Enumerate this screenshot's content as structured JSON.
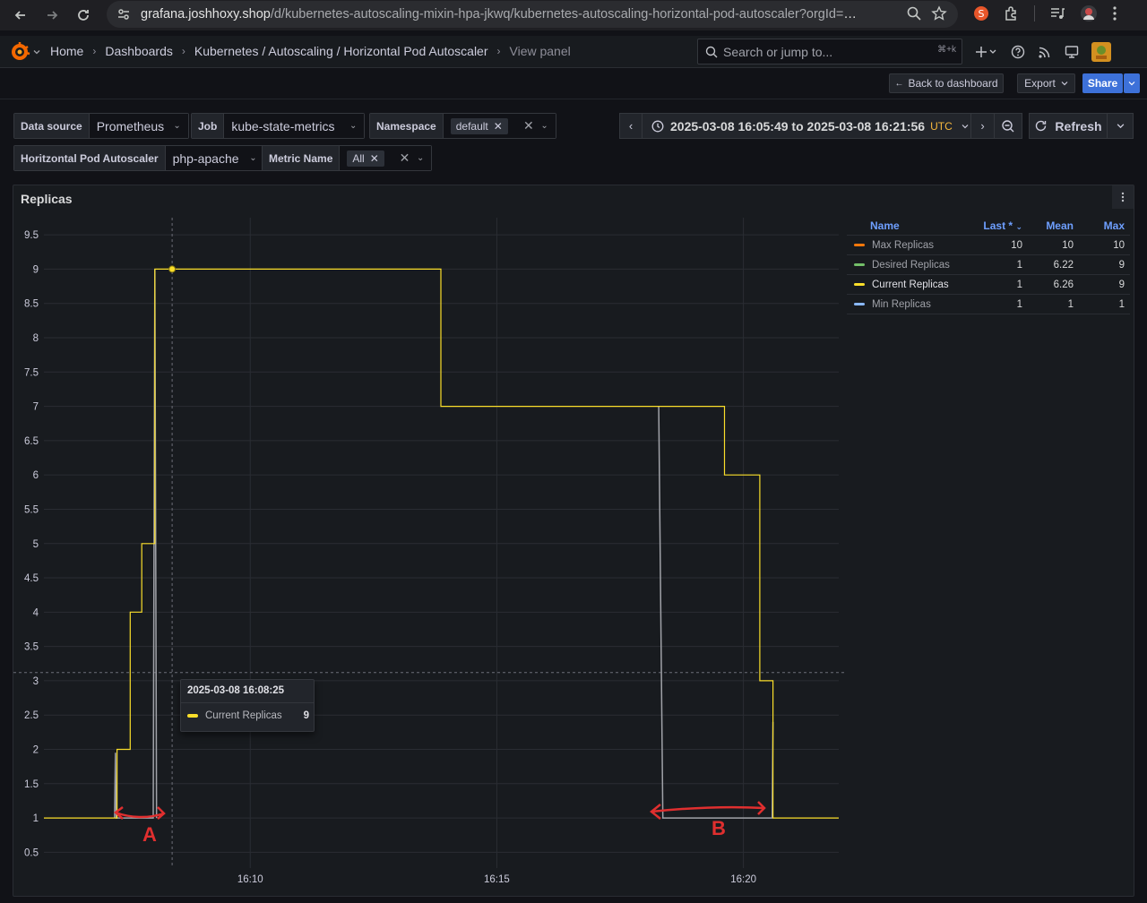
{
  "browser": {
    "url_host": "grafana.joshhoxy.shop",
    "url_path": "/d/kubernetes-autoscaling-mixin-hpa-jkwq/kubernetes-autoscaling-horizontal-pod-autoscaler?orgId="
  },
  "nav": {
    "breadcrumbs": [
      "Home",
      "Dashboards",
      "Kubernetes / Autoscaling / Horizontal Pod Autoscaler",
      "View panel"
    ],
    "search_placeholder": "Search or jump to...",
    "search_shortcut": "⌘+k"
  },
  "toolbar": {
    "back_label": "Back to dashboard",
    "export_label": "Export",
    "share_label": "Share"
  },
  "variables": {
    "datasource": {
      "label": "Data source",
      "value": "Prometheus"
    },
    "job": {
      "label": "Job",
      "value": "kube-state-metrics"
    },
    "namespace": {
      "label": "Namespace",
      "value": "default"
    },
    "hpa": {
      "label": "Horitzontal Pod Autoscaler",
      "value": "php-apache"
    },
    "metric": {
      "label": "Metric Name",
      "value": "All"
    }
  },
  "time": {
    "range": "2025-03-08 16:05:49 to 2025-03-08 16:21:56",
    "tz": "UTC",
    "refresh_label": "Refresh"
  },
  "panel": {
    "title": "Replicas"
  },
  "legend": {
    "headers": {
      "name": "Name",
      "last": "Last *",
      "mean": "Mean",
      "max": "Max"
    },
    "rows": [
      {
        "name": "Max Replicas",
        "color": "#ff780a",
        "last": "10",
        "mean": "10",
        "max": "10"
      },
      {
        "name": "Desired Replicas",
        "color": "#73bf69",
        "last": "1",
        "mean": "6.22",
        "max": "9"
      },
      {
        "name": "Current Replicas",
        "color": "#fade2a",
        "last": "1",
        "mean": "6.26",
        "max": "9"
      },
      {
        "name": "Min Replicas",
        "color": "#8ab8ff",
        "last": "1",
        "mean": "1",
        "max": "1"
      }
    ]
  },
  "tooltip": {
    "time": "2025-03-08 16:08:25",
    "series": "Current Replicas",
    "value": "9"
  },
  "annotations": {
    "a": "A",
    "b": "B"
  },
  "chart_data": {
    "type": "line",
    "y_ticks": [
      "0.5",
      "1",
      "1.5",
      "2",
      "2.5",
      "3",
      "3.5",
      "4",
      "4.5",
      "5",
      "5.5",
      "6",
      "6.5",
      "7",
      "7.5",
      "8",
      "8.5",
      "9",
      "9.5"
    ],
    "x_ticks": [
      "16:10",
      "16:15",
      "16:20"
    ],
    "ylim": [
      0.27,
      9.75
    ],
    "xlim": [
      "16:05:49",
      "16:21:56"
    ],
    "x_tick_values": [
      "16:10:00",
      "16:15:00",
      "16:20:00"
    ],
    "series": [
      {
        "name": "Current Replicas",
        "color": "#fade2a",
        "points": [
          [
            "16:05:49",
            1
          ],
          [
            "16:07:18",
            1
          ],
          [
            "16:07:18",
            2
          ],
          [
            "16:07:34",
            2
          ],
          [
            "16:07:34",
            4
          ],
          [
            "16:07:48",
            4
          ],
          [
            "16:07:48",
            5
          ],
          [
            "16:08:04",
            5
          ],
          [
            "16:08:04",
            9
          ],
          [
            "16:13:52",
            9
          ],
          [
            "16:13:52",
            7
          ],
          [
            "16:19:37",
            7
          ],
          [
            "16:19:37",
            6
          ],
          [
            "16:20:20",
            6
          ],
          [
            "16:20:20",
            3
          ],
          [
            "16:20:36",
            3
          ],
          [
            "16:20:36",
            1
          ],
          [
            "16:21:56",
            1
          ]
        ]
      },
      {
        "name": "Desired Replicas",
        "color": "#a0a2a8",
        "points": [
          [
            "16:07:15",
            1
          ],
          [
            "16:07:16",
            1.95
          ],
          [
            "16:07:17",
            1
          ],
          [
            "16:08:02",
            1
          ],
          [
            "16:08:04",
            9
          ],
          [
            "16:08:06",
            1
          ]
        ]
      },
      {
        "name": "Desired Replicas",
        "color": "#a0a2a8",
        "points": [
          [
            "16:18:17",
            7
          ],
          [
            "16:18:22",
            1
          ],
          [
            "16:20:35",
            1
          ],
          [
            "16:20:36",
            2.4
          ]
        ]
      }
    ],
    "hover": {
      "x": "16:08:25",
      "y": 9
    },
    "crosshair_y": 3.12
  }
}
